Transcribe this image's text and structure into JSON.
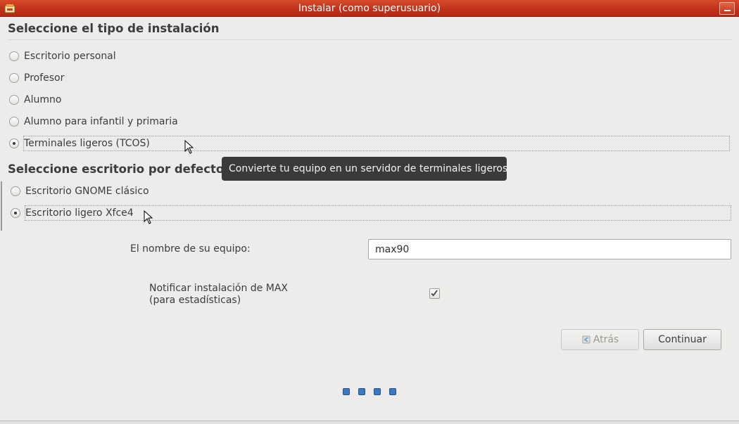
{
  "window": {
    "title": "Instalar (como superusuario)"
  },
  "install_type": {
    "heading": "Seleccione el tipo de instalación",
    "options": [
      {
        "label": "Escritorio personal",
        "selected": false
      },
      {
        "label": "Profesor",
        "selected": false
      },
      {
        "label": "Alumno",
        "selected": false
      },
      {
        "label": "Alumno para infantil y primaria",
        "selected": false
      },
      {
        "label": "Terminales ligeros (TCOS)",
        "selected": true
      }
    ]
  },
  "tooltip": {
    "text": "Convierte tu equipo en un servidor de terminales ligeros."
  },
  "desktop": {
    "heading": "Seleccione escritorio por defecto",
    "options": [
      {
        "label": "Escritorio GNOME clásico",
        "selected": false
      },
      {
        "label": "Escritorio ligero Xfce4",
        "selected": true
      }
    ]
  },
  "hostname": {
    "label": "El nombre de su equipo:",
    "value": "max90"
  },
  "notify": {
    "label_line1": "Notificar instalación de MAX",
    "label_line2": "(para estadísticas)",
    "checked": true
  },
  "buttons": {
    "back_label": "Atrás",
    "back_enabled": false,
    "continue_label": "Continuar"
  },
  "colors": {
    "titlebar": "#c1301a",
    "progress_dots": "#3a79c4"
  }
}
